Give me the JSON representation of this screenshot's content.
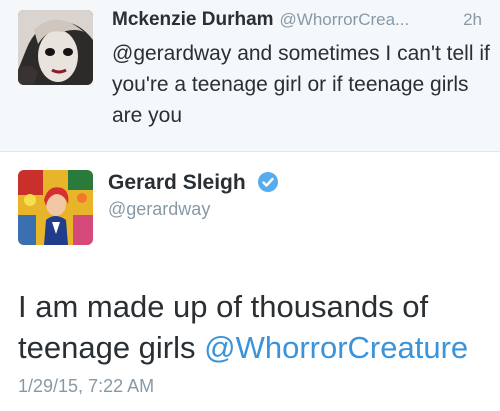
{
  "reply": {
    "author_name": "Mckenzie Durham",
    "author_handle": "@WhorrorCrea...",
    "time": "2h",
    "text": "@gerardway and sometimes I can't tell if you're a teenage girl or if teenage girls are you"
  },
  "tweet": {
    "author_name": "Gerard Sleigh",
    "author_handle": "@gerardway",
    "verified_icon": "verified-badge-icon",
    "text_plain": "I am made up of thousands of teenage girls ",
    "mention": "@WhorrorCreature",
    "timestamp": "1/29/15, 7:22 AM"
  },
  "colors": {
    "link": "#3b94d9",
    "muted": "#8899a6",
    "reply_bg": "#f5f8fa"
  }
}
